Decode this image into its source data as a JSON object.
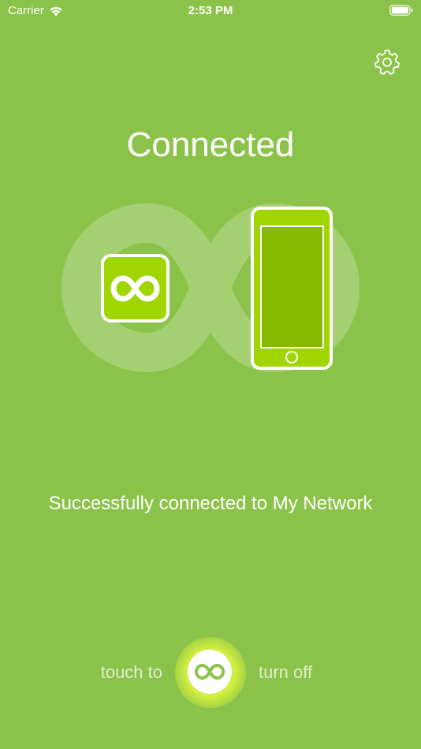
{
  "status_bar": {
    "carrier": "Carrier",
    "time": "2:53 PM"
  },
  "title": "Connected",
  "message": "Successfully connected to My Network",
  "bottom": {
    "left_label": "touch to",
    "right_label": "turn off"
  },
  "icons": {
    "settings": "gear-icon",
    "wifi": "wifi-icon",
    "battery": "battery-icon",
    "app_logo": "infinity-logo-icon",
    "device": "smartphone-icon",
    "power": "infinity-logo-icon"
  },
  "colors": {
    "background": "#8bc34a",
    "accent": "#9fd600",
    "phone_screen": "#86ba00",
    "glow": "#e4f53a"
  }
}
